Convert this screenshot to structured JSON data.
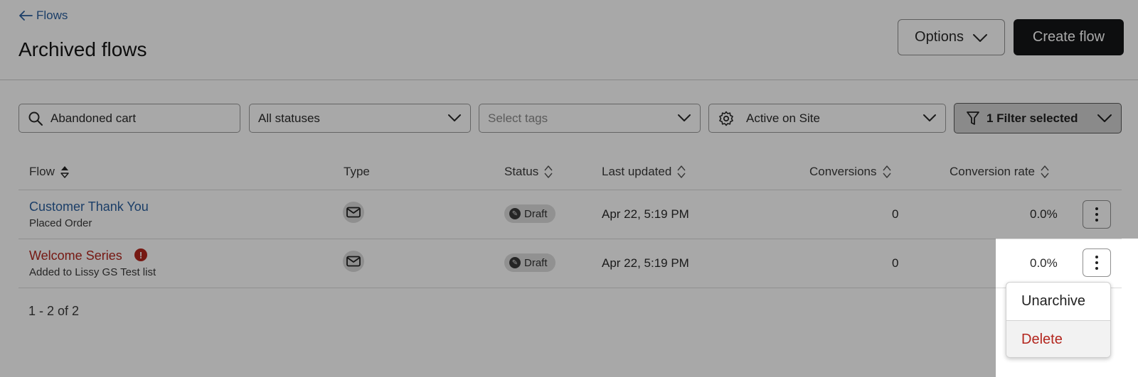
{
  "header": {
    "back_label": "Flows",
    "title": "Archived flows",
    "options_label": "Options",
    "create_label": "Create flow"
  },
  "filters": {
    "search_value": "Abandoned cart",
    "status_value": "All statuses",
    "tags_placeholder": "Select tags",
    "site_value": "Active on Site",
    "filter_button_label": "1 Filter selected"
  },
  "table": {
    "columns": [
      "Flow",
      "Type",
      "Status",
      "Last updated",
      "Conversions",
      "Conversion rate"
    ],
    "rows": [
      {
        "name": "Customer Thank You",
        "trigger": "Placed Order",
        "type_icon": "email-icon",
        "status": "Draft",
        "last_updated": "Apr 22, 5:19 PM",
        "conversions": "0",
        "conversion_rate": "0.0%",
        "has_error": false
      },
      {
        "name": "Welcome Series",
        "trigger": "Added to Lissy GS Test list",
        "type_icon": "email-icon",
        "status": "Draft",
        "last_updated": "Apr 22, 5:19 PM",
        "conversions": "0",
        "conversion_rate": "0.0%",
        "has_error": true,
        "error_icon": "!"
      }
    ],
    "pagination": "1 - 2 of 2"
  },
  "row_menu": {
    "items": [
      "Unarchive",
      "Delete"
    ]
  },
  "colors": {
    "link_blue": "#2a5f9e",
    "error_red": "#b3261e",
    "primary_button": "#151617"
  }
}
